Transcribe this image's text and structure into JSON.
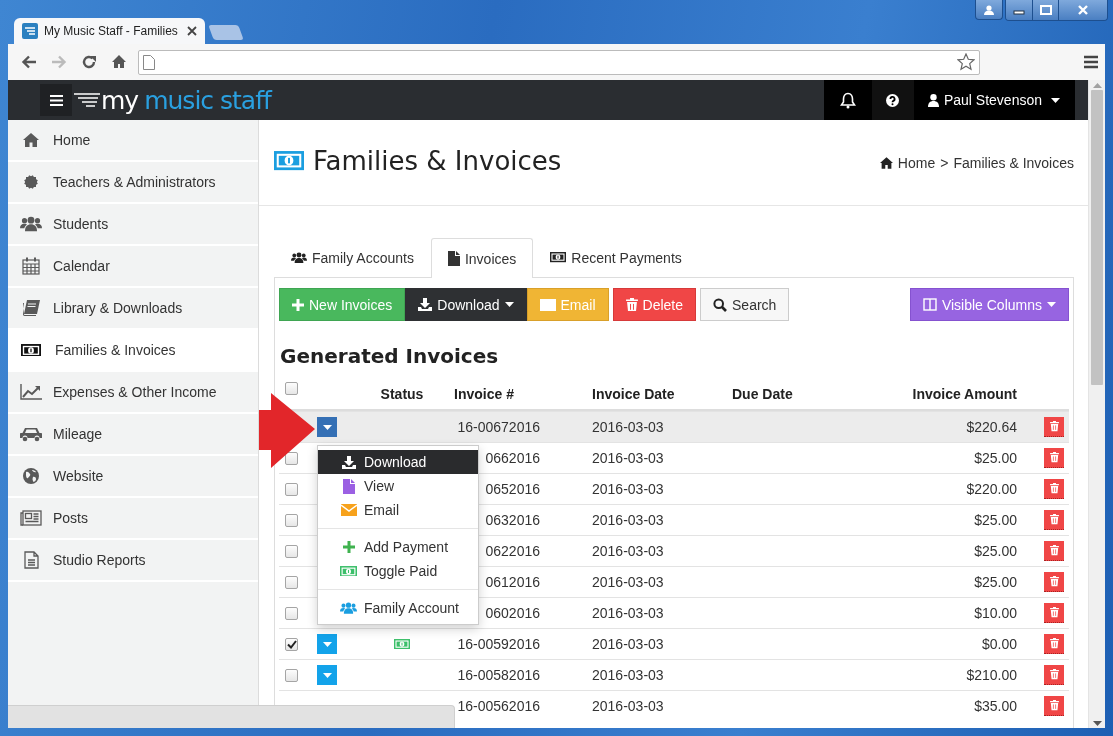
{
  "browser": {
    "tab_title": "My Music Staff - Families"
  },
  "navbar": {
    "logo_first": "my",
    "logo_rest": "music staff",
    "user": "Paul Stevenson"
  },
  "sidebar": {
    "items": [
      {
        "label": "Home",
        "selected": false
      },
      {
        "label": "Teachers & Administrators",
        "selected": false
      },
      {
        "label": "Students",
        "selected": false
      },
      {
        "label": "Calendar",
        "selected": false
      },
      {
        "label": "Library & Downloads",
        "selected": false
      },
      {
        "label": "Families & Invoices",
        "selected": true
      },
      {
        "label": "Expenses & Other Income",
        "selected": false
      },
      {
        "label": "Mileage",
        "selected": false
      },
      {
        "label": "Website",
        "selected": false
      },
      {
        "label": "Posts",
        "selected": false
      },
      {
        "label": "Studio Reports",
        "selected": false
      }
    ]
  },
  "page": {
    "title": "Families & Invoices",
    "breadcrumb": [
      "Home",
      "Families & Invoices"
    ],
    "breadcrumb_separator": ">"
  },
  "tabs": [
    {
      "label": "Family Accounts",
      "selected": false
    },
    {
      "label": "Invoices",
      "selected": true
    },
    {
      "label": "Recent Payments",
      "selected": false
    }
  ],
  "toolbar": [
    {
      "label": "New Invoices",
      "kind": "new",
      "dropdown": false
    },
    {
      "label": "Download",
      "kind": "download",
      "dropdown": true
    },
    {
      "label": "Email",
      "kind": "email",
      "dropdown": false
    },
    {
      "label": "Delete",
      "kind": "delete",
      "dropdown": false
    },
    {
      "label": "Search",
      "kind": "search",
      "dropdown": false
    },
    {
      "label": "Visible Columns",
      "kind": "columns",
      "dropdown": true
    }
  ],
  "section_title": "Generated Invoices",
  "table": {
    "header_checked": false,
    "columns": [
      "Status",
      "Invoice #",
      "Invoice Date",
      "Due Date",
      "Invoice Amount"
    ],
    "rows": [
      {
        "highlighted": true,
        "menu_open": true,
        "paid": false,
        "invoice": "16-00672016",
        "date": "2016-03-03",
        "amount": "$220.64"
      },
      {
        "highlighted": false,
        "checked": false,
        "paid": false,
        "invoice": "0662016",
        "date": "2016-03-03",
        "amount": "$25.00"
      },
      {
        "highlighted": false,
        "checked": false,
        "paid": false,
        "invoice": "0652016",
        "date": "2016-03-03",
        "amount": "$220.00"
      },
      {
        "highlighted": false,
        "checked": false,
        "paid": false,
        "invoice": "0632016",
        "date": "2016-03-03",
        "amount": "$25.00"
      },
      {
        "highlighted": false,
        "checked": false,
        "paid": false,
        "invoice": "0622016",
        "date": "2016-03-03",
        "amount": "$25.00"
      },
      {
        "highlighted": false,
        "checked": false,
        "paid": false,
        "invoice": "0612016",
        "date": "2016-03-03",
        "amount": "$25.00"
      },
      {
        "highlighted": false,
        "checked": false,
        "paid": false,
        "invoice": "0602016",
        "date": "2016-03-03",
        "amount": "$10.00"
      },
      {
        "highlighted": false,
        "checked": true,
        "menu_open": false,
        "paid": true,
        "invoice": "16-00592016",
        "date": "2016-03-03",
        "amount": "$0.00"
      },
      {
        "highlighted": false,
        "checked": false,
        "menu_open": false,
        "paid": false,
        "invoice": "16-00582016",
        "date": "2016-03-03",
        "amount": "$210.00"
      },
      {
        "highlighted": false,
        "paid": false,
        "invoice": "16-00562016",
        "date": "2016-03-03",
        "amount": "$35.00"
      }
    ]
  },
  "row_menu": {
    "items": [
      {
        "kind": "download",
        "label": "Download",
        "selected": true
      },
      {
        "kind": "view",
        "label": "View",
        "selected": false
      },
      {
        "kind": "email",
        "label": "Email",
        "selected": false
      },
      {
        "kind": "divider"
      },
      {
        "kind": "payment",
        "label": "Add Payment",
        "selected": false
      },
      {
        "kind": "paid",
        "label": "Toggle Paid",
        "selected": false
      },
      {
        "kind": "divider"
      },
      {
        "kind": "family",
        "label": "Family Account",
        "selected": false
      }
    ]
  }
}
